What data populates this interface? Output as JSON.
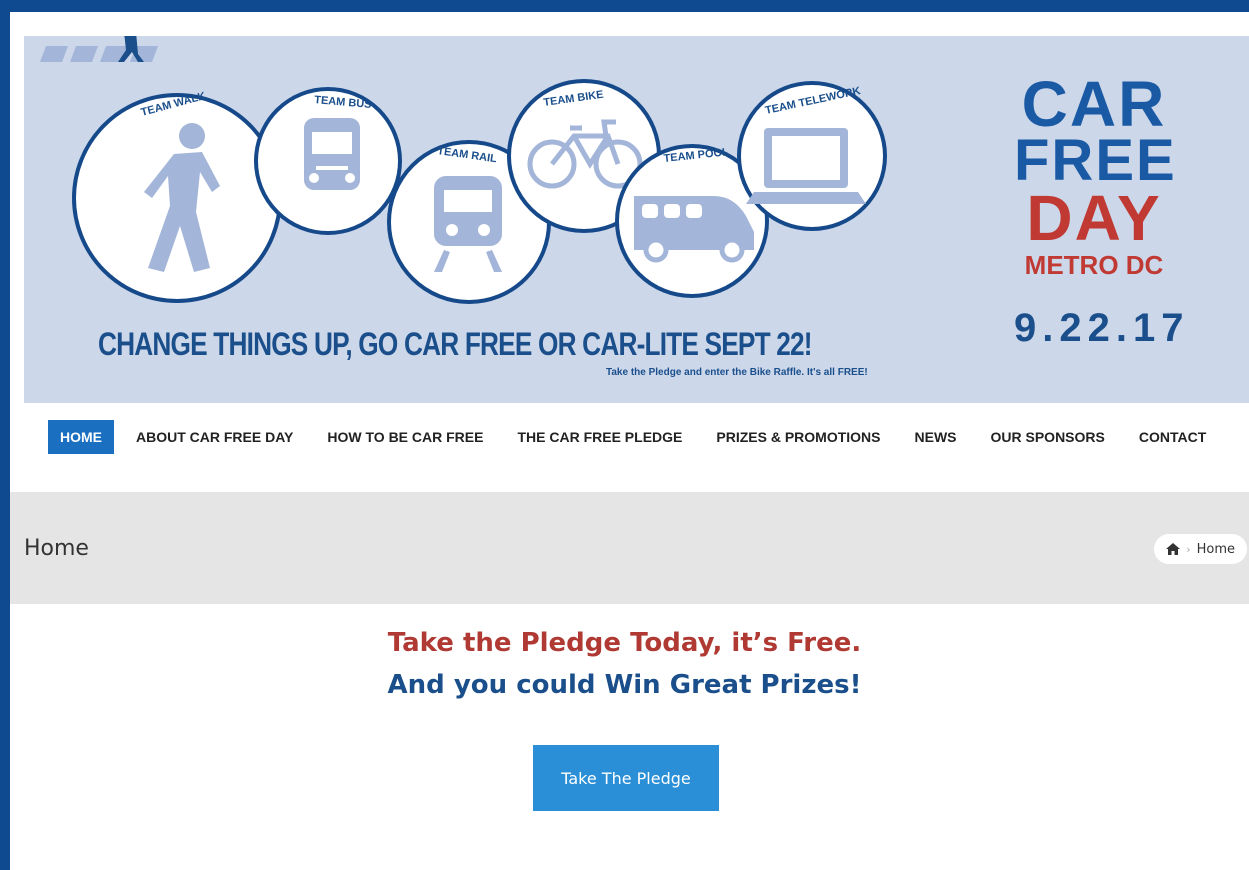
{
  "banner": {
    "teams": [
      "TEAM WALK",
      "TEAM BUS",
      "TEAM RAIL",
      "TEAM BIKE",
      "TEAM POOL",
      "TEAM TELEWORK"
    ],
    "tagline": "CHANGE THINGS UP, GO CAR FREE OR CAR-LITE SEPT 22!",
    "subtagline": "Take the Pledge and enter the Bike Raffle. It's all FREE!",
    "logo": {
      "line1": "CAR",
      "line2": "FREE",
      "line3": "DAY",
      "line4": "METRO DC",
      "date": "9.22.17"
    }
  },
  "nav": {
    "items": [
      {
        "label": "HOME",
        "active": true
      },
      {
        "label": "ABOUT CAR FREE DAY"
      },
      {
        "label": "HOW TO BE CAR FREE"
      },
      {
        "label": "THE CAR FREE PLEDGE"
      },
      {
        "label": "PRIZES & PROMOTIONS"
      },
      {
        "label": "NEWS"
      },
      {
        "label": "OUR SPONSORS"
      },
      {
        "label": "CONTACT"
      }
    ]
  },
  "titlebar": {
    "title": "Home",
    "breadcrumb": {
      "icon": "home-icon",
      "current": "Home"
    }
  },
  "main": {
    "headline1": "Take the Pledge Today, it’s Free.",
    "headline2": "And you could Win Great Prizes!",
    "button": "Take The Pledge"
  },
  "colors": {
    "frame": "#0f4a90",
    "banner_bg": "#ccd7ea",
    "nav_active": "#1a6fc1",
    "headline_red": "#b03a33",
    "headline_blue": "#1a4f8b",
    "button": "#2a8fd6"
  }
}
